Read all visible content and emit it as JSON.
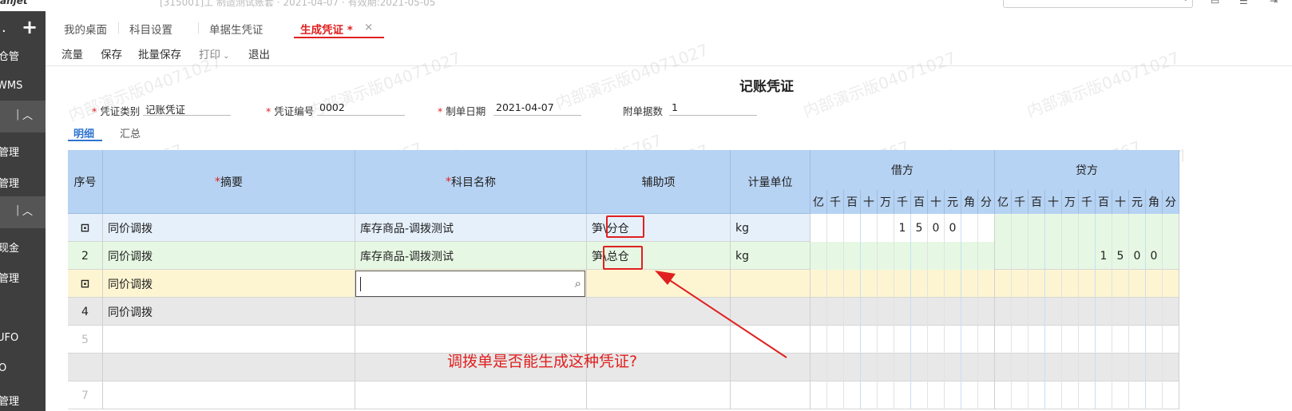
{
  "topbar": {
    "brand": "anjet",
    "meta": "[315001]工   制造测试账套   ·   2021-04-07   ·   有效期:2021-05-05",
    "icons": [
      "window-icon",
      "menu-icon",
      "logout-icon"
    ]
  },
  "sidebar": {
    "items": [
      "仓管",
      "WMS",
      "管理",
      "管理",
      "现金",
      "管理",
      "UFO",
      "O",
      "管理"
    ]
  },
  "tabs": [
    {
      "label": "我的桌面"
    },
    {
      "label": "科目设置"
    },
    {
      "label": "单据生凭证"
    },
    {
      "label": "生成凭证 *"
    }
  ],
  "toolbar": {
    "items": [
      "流量",
      "保存",
      "批量保存",
      "打印",
      "退出"
    ]
  },
  "voucher": {
    "title": "记账凭证",
    "fields": {
      "type_label": "凭证类别",
      "type_value": "记账凭证",
      "no_label": "凭证编号",
      "no_value": "0002",
      "date_label": "制单日期",
      "date_value": "2021-04-07",
      "attach_label": "附单据数",
      "attach_value": "1"
    },
    "subtabs": [
      "明细",
      "汇总"
    ]
  },
  "grid": {
    "headers": {
      "seq": "序号",
      "summary": "摘要",
      "account": "科目名称",
      "aux": "辅助项",
      "unit": "计量单位",
      "debit": "借方",
      "credit": "贷方"
    },
    "digit_units": [
      "亿",
      "千",
      "百",
      "十",
      "万",
      "千",
      "百",
      "十",
      "元",
      "角",
      "分"
    ],
    "rows": [
      {
        "seq": "",
        "summary": "同价调拨",
        "account": "库存商品-调拨测试",
        "aux": "笋\\分仓",
        "unit": "kg",
        "debit": [
          "",
          "",
          "",
          "",
          "",
          "1",
          "5",
          "0",
          "0",
          "",
          " "
        ],
        "credit": [
          "",
          "",
          "",
          "",
          "",
          "",
          "",
          "",
          "",
          "",
          ""
        ]
      },
      {
        "seq": "2",
        "summary": "同价调拨",
        "account": "库存商品-调拨测试",
        "aux": "笋\\总仓",
        "unit": "kg",
        "debit": [
          "",
          "",
          "",
          "",
          "",
          "",
          "",
          "",
          "",
          "",
          ""
        ],
        "credit": [
          "",
          "",
          "",
          "",
          "",
          "",
          "1",
          "5",
          "0",
          "0",
          ""
        ]
      },
      {
        "seq": "",
        "summary": "同价调拨",
        "account": "",
        "aux": "",
        "unit": "",
        "debit": [
          "",
          "",
          "",
          "",
          "",
          "",
          "",
          "",
          "",
          "",
          ""
        ],
        "credit": [
          "",
          "",
          "",
          "",
          "",
          "",
          "",
          "",
          "",
          "",
          ""
        ]
      },
      {
        "seq": "4",
        "summary": "同价调拨",
        "account": "",
        "aux": "",
        "unit": "",
        "debit": [
          "",
          "",
          "",
          "",
          "",
          "",
          "",
          "",
          "",
          "",
          ""
        ],
        "credit": [
          "",
          "",
          "",
          "",
          "",
          "",
          "",
          "",
          "",
          "",
          ""
        ]
      },
      {
        "seq": "5",
        "summary": "",
        "account": "",
        "aux": "",
        "unit": "",
        "debit": [
          "",
          "",
          "",
          "",
          "",
          "",
          "",
          "",
          "",
          "",
          ""
        ],
        "credit": [
          "",
          "",
          "",
          "",
          "",
          "",
          "",
          "",
          "",
          "",
          ""
        ]
      },
      {
        "seq": "",
        "summary": "",
        "account": "",
        "aux": "",
        "unit": "",
        "debit": [
          "",
          "",
          "",
          "",
          "",
          "",
          "",
          "",
          "",
          "",
          ""
        ],
        "credit": [
          "",
          "",
          "",
          "",
          "",
          "",
          "",
          "",
          "",
          "",
          ""
        ]
      },
      {
        "seq": "7",
        "summary": "",
        "account": "",
        "aux": "",
        "unit": "",
        "debit": [
          "",
          "",
          "",
          "",
          "",
          "",
          "",
          "",
          "",
          "",
          ""
        ],
        "credit": [
          "",
          "",
          "",
          "",
          "",
          "",
          "",
          "",
          "",
          "",
          ""
        ]
      }
    ]
  },
  "annotation": {
    "text": "调拨单是否能生成这种凭证?"
  },
  "watermarks": [
    "内部演示版04071027",
    "韦金妹5767"
  ],
  "colors": {
    "accent_red": "#e02020",
    "header_blue": "#b7d3f3",
    "row1_bg": "#e6f0fb",
    "row2_bg": "#e6f8e3",
    "row3_bg": "#fdf5d2",
    "row_gray": "#e8e8e8"
  }
}
